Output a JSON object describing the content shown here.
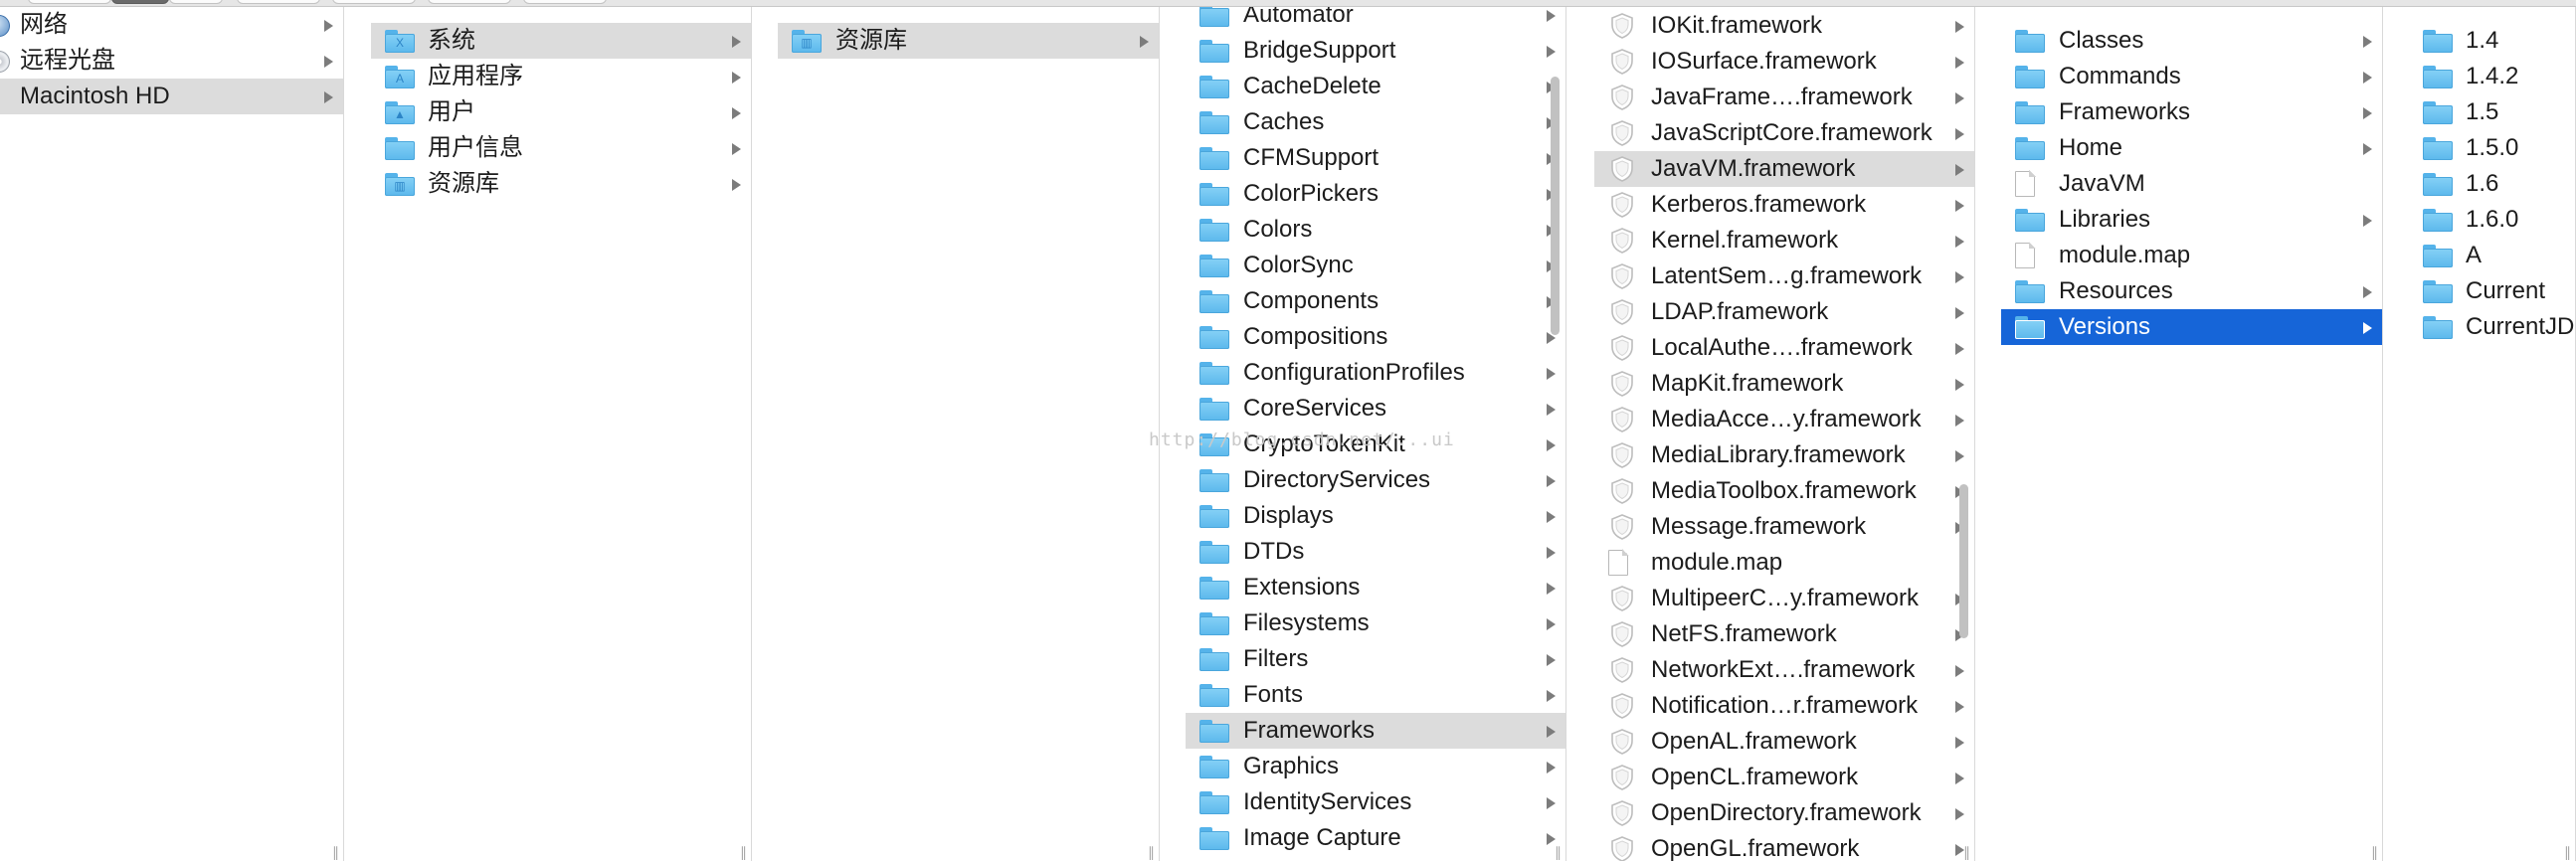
{
  "columns": [
    {
      "id": "col1",
      "items": [
        {
          "label": "网络",
          "icon": "globe-icon",
          "chevron": true
        },
        {
          "label": "远程光盘",
          "icon": "optical-disc-icon",
          "chevron": true
        },
        {
          "label": "Macintosh HD",
          "icon": "hard-drive-icon",
          "chevron": true,
          "selected": "gray"
        }
      ]
    },
    {
      "id": "col2",
      "items": [
        {
          "label": "系统",
          "icon": "system-folder-icon",
          "chevron": true,
          "selected": "gray"
        },
        {
          "label": "应用程序",
          "icon": "applications-folder-icon",
          "chevron": true
        },
        {
          "label": "用户",
          "icon": "users-folder-icon",
          "chevron": true
        },
        {
          "label": "用户信息",
          "icon": "folder-icon",
          "chevron": true
        },
        {
          "label": "资源库",
          "icon": "library-folder-icon",
          "chevron": true
        }
      ]
    },
    {
      "id": "col3",
      "items": [
        {
          "label": "资源库",
          "icon": "library-folder-icon",
          "chevron": true,
          "selected": "gray"
        }
      ]
    },
    {
      "id": "col4",
      "items": [
        {
          "label": "Automator",
          "icon": "folder-icon",
          "chevron": true
        },
        {
          "label": "BridgeSupport",
          "icon": "folder-icon",
          "chevron": true
        },
        {
          "label": "CacheDelete",
          "icon": "folder-icon",
          "chevron": true
        },
        {
          "label": "Caches",
          "icon": "folder-icon",
          "chevron": true
        },
        {
          "label": "CFMSupport",
          "icon": "folder-icon",
          "chevron": true
        },
        {
          "label": "ColorPickers",
          "icon": "folder-icon",
          "chevron": true
        },
        {
          "label": "Colors",
          "icon": "folder-icon",
          "chevron": true
        },
        {
          "label": "ColorSync",
          "icon": "folder-icon",
          "chevron": true
        },
        {
          "label": "Components",
          "icon": "folder-icon",
          "chevron": true
        },
        {
          "label": "Compositions",
          "icon": "folder-icon",
          "chevron": true
        },
        {
          "label": "ConfigurationProfiles",
          "icon": "folder-icon",
          "chevron": true
        },
        {
          "label": "CoreServices",
          "icon": "folder-icon",
          "chevron": true
        },
        {
          "label": "CryptoTokenKit",
          "icon": "folder-icon",
          "chevron": true
        },
        {
          "label": "DirectoryServices",
          "icon": "folder-icon",
          "chevron": true
        },
        {
          "label": "Displays",
          "icon": "folder-icon",
          "chevron": true
        },
        {
          "label": "DTDs",
          "icon": "folder-icon",
          "chevron": true
        },
        {
          "label": "Extensions",
          "icon": "folder-icon",
          "chevron": true
        },
        {
          "label": "Filesystems",
          "icon": "folder-icon",
          "chevron": true
        },
        {
          "label": "Filters",
          "icon": "folder-icon",
          "chevron": true
        },
        {
          "label": "Fonts",
          "icon": "folder-icon",
          "chevron": true
        },
        {
          "label": "Frameworks",
          "icon": "folder-icon",
          "chevron": true,
          "selected": "gray"
        },
        {
          "label": "Graphics",
          "icon": "folder-icon",
          "chevron": true
        },
        {
          "label": "IdentityServices",
          "icon": "folder-icon",
          "chevron": true
        },
        {
          "label": "Image Capture",
          "icon": "folder-icon",
          "chevron": true
        }
      ]
    },
    {
      "id": "col5",
      "items": [
        {
          "label": "IOKit.framework",
          "icon": "framework-icon",
          "chevron": true
        },
        {
          "label": "IOSurface.framework",
          "icon": "framework-icon",
          "chevron": true
        },
        {
          "label": "JavaFrame….framework",
          "icon": "framework-icon",
          "chevron": true
        },
        {
          "label": "JavaScriptCore.framework",
          "icon": "framework-icon",
          "chevron": true
        },
        {
          "label": "JavaVM.framework",
          "icon": "framework-icon",
          "chevron": true,
          "selected": "gray"
        },
        {
          "label": "Kerberos.framework",
          "icon": "framework-icon",
          "chevron": true
        },
        {
          "label": "Kernel.framework",
          "icon": "framework-icon",
          "chevron": true
        },
        {
          "label": "LatentSem…g.framework",
          "icon": "framework-icon",
          "chevron": true
        },
        {
          "label": "LDAP.framework",
          "icon": "framework-icon",
          "chevron": true
        },
        {
          "label": "LocalAuthe….framework",
          "icon": "framework-icon",
          "chevron": true
        },
        {
          "label": "MapKit.framework",
          "icon": "framework-icon",
          "chevron": true
        },
        {
          "label": "MediaAcce…y.framework",
          "icon": "framework-icon",
          "chevron": true
        },
        {
          "label": "MediaLibrary.framework",
          "icon": "framework-icon",
          "chevron": true
        },
        {
          "label": "MediaToolbox.framework",
          "icon": "framework-icon",
          "chevron": true
        },
        {
          "label": "Message.framework",
          "icon": "framework-icon",
          "chevron": true
        },
        {
          "label": "module.map",
          "icon": "document-icon",
          "chevron": false
        },
        {
          "label": "MultipeerC…y.framework",
          "icon": "framework-icon",
          "chevron": true
        },
        {
          "label": "NetFS.framework",
          "icon": "framework-icon",
          "chevron": true
        },
        {
          "label": "NetworkExt….framework",
          "icon": "framework-icon",
          "chevron": true
        },
        {
          "label": "Notification…r.framework",
          "icon": "framework-icon",
          "chevron": true
        },
        {
          "label": "OpenAL.framework",
          "icon": "framework-icon",
          "chevron": true
        },
        {
          "label": "OpenCL.framework",
          "icon": "framework-icon",
          "chevron": true
        },
        {
          "label": "OpenDirectory.framework",
          "icon": "framework-icon",
          "chevron": true
        },
        {
          "label": "OpenGL.framework",
          "icon": "framework-icon",
          "chevron": true
        }
      ]
    },
    {
      "id": "col6",
      "items": [
        {
          "label": "Classes",
          "icon": "folder-icon",
          "chevron": true
        },
        {
          "label": "Commands",
          "icon": "folder-icon",
          "chevron": true
        },
        {
          "label": "Frameworks",
          "icon": "folder-icon",
          "chevron": true
        },
        {
          "label": "Home",
          "icon": "folder-icon",
          "chevron": true
        },
        {
          "label": "JavaVM",
          "icon": "document-icon",
          "chevron": false
        },
        {
          "label": "Libraries",
          "icon": "folder-icon",
          "chevron": true
        },
        {
          "label": "module.map",
          "icon": "document-icon",
          "chevron": false
        },
        {
          "label": "Resources",
          "icon": "folder-icon",
          "chevron": true
        },
        {
          "label": "Versions",
          "icon": "folder-icon",
          "chevron": true,
          "selected": "blue"
        }
      ]
    },
    {
      "id": "col7",
      "items": [
        {
          "label": "1.4",
          "icon": "folder-icon",
          "chevron": false
        },
        {
          "label": "1.4.2",
          "icon": "folder-icon",
          "chevron": false
        },
        {
          "label": "1.5",
          "icon": "folder-icon",
          "chevron": false
        },
        {
          "label": "1.5.0",
          "icon": "folder-icon",
          "chevron": false
        },
        {
          "label": "1.6",
          "icon": "folder-icon",
          "chevron": false
        },
        {
          "label": "1.6.0",
          "icon": "folder-icon",
          "chevron": false
        },
        {
          "label": "A",
          "icon": "folder-icon",
          "chevron": false
        },
        {
          "label": "Current",
          "icon": "folder-icon",
          "chevron": false
        },
        {
          "label": "CurrentJDK",
          "icon": "folder-icon",
          "chevron": false
        }
      ]
    }
  ],
  "watermark": "http://blog.csdn.net/...ui",
  "colors": {
    "selection_gray": "#dcdcdc",
    "selection_blue": "#1665d8",
    "folder_blue": "#5bb8ec"
  }
}
